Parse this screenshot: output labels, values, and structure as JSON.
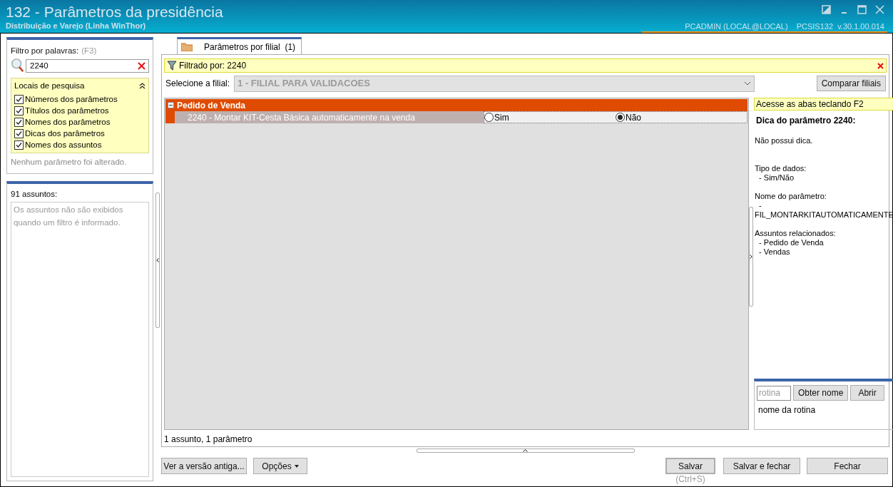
{
  "window": {
    "title": "132 - Parâmetros da presidência",
    "subtitle": "Distribuição e Varejo (Linha WinThor)",
    "user": "PCADMIN (LOCAL@LOCAL)",
    "program": "PCSIS132",
    "version": "v.30.1.00.014"
  },
  "filter": {
    "label": "Filtro por palavras:",
    "shortcut": "(F3)",
    "value": "2240",
    "places_title": "Locais de pesquisa",
    "places": [
      {
        "label": "Números dos parâmetros",
        "checked": true
      },
      {
        "label": "Títulos dos parâmetros",
        "checked": true
      },
      {
        "label": "Nomes dos parâmetros",
        "checked": true
      },
      {
        "label": "Dicas dos parâmetros",
        "checked": true
      },
      {
        "label": "Nomes dos assuntos",
        "checked": true
      }
    ],
    "status": "Nenhum parâmetro foi alterado."
  },
  "subjects": {
    "title": "91 assuntos:",
    "note": "Os assuntos não são exibidos quando um filtro é informado."
  },
  "tabs": [
    {
      "label": "Parâmetros por filial",
      "count": "(1)",
      "selected": true
    }
  ],
  "filtered_by": "Filtrado por: 2240",
  "branch": {
    "label": "Selecione a filial:",
    "value": "1 - FILIAL PARA VALIDACOES",
    "compare": "Comparar filiais"
  },
  "groups": [
    {
      "title": "Pedido de Venda",
      "expanded": true,
      "params": [
        {
          "title": "2240 - Montar KIT-Cesta Básica automaticamente na venda",
          "options": [
            {
              "label": "Sim",
              "selected": false
            },
            {
              "label": "Não",
              "selected": true
            }
          ]
        }
      ]
    }
  ],
  "grid_status": "1 assunto, 1 parâmetro",
  "hint": {
    "banner": "Acesse as abas teclando F2",
    "title": "Dica do parâmetro 2240:",
    "sections": [
      {
        "lines": [
          "Não possui dica."
        ]
      },
      {
        "lines": [
          "Tipo de dados:",
          "  - Sim/Não"
        ]
      },
      {
        "lines": [
          "Nome do parâmetro:",
          "  -",
          "FIL_MONTARKITAUTOMATICAMENTE"
        ]
      },
      {
        "lines": [
          "Assuntos relacionados:",
          "  - Pedido de Venda",
          "  - Vendas"
        ]
      }
    ]
  },
  "routine": {
    "placeholder": "rotina",
    "get_name": "Obter nome",
    "open": "Abrir",
    "name_label": "nome da rotina"
  },
  "buttons": {
    "old_version": "Ver a versão antiga...",
    "options": "Opções",
    "save": "Salvar",
    "save_shortcut": "(Ctrl+S)",
    "save_close": "Salvar e fechar",
    "close": "Fechar"
  }
}
